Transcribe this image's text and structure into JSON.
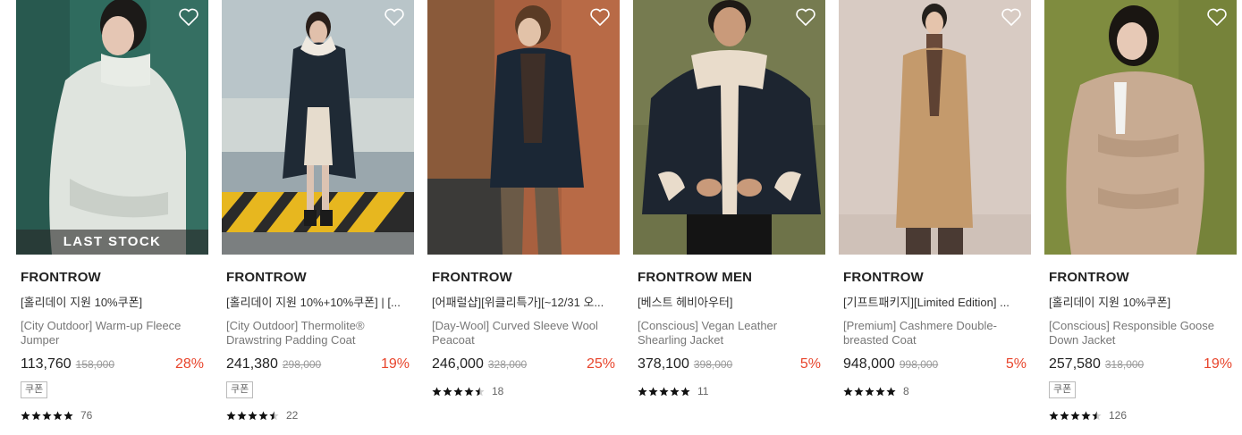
{
  "colors": {
    "discount": "#e8452c",
    "badge_bg": "#3a3a3a"
  },
  "products": [
    {
      "brand": "FRONTROW",
      "promo": "[홀리데이 지원 10%쿠폰]",
      "name": "[City Outdoor] Warm-up Fleece Jumper",
      "price": "113,760",
      "original_price": "158,000",
      "discount": "28%",
      "badge": "LAST STOCK",
      "coupon": "쿠폰",
      "rating": 5,
      "reviews": "76",
      "icon": "heart-outline-icon"
    },
    {
      "brand": "FRONTROW",
      "promo": "[홀리데이 지원 10%+10%쿠폰] | [...",
      "name": "[City Outdoor] Thermolite® Drawstring Padding Coat",
      "price": "241,380",
      "original_price": "298,000",
      "discount": "19%",
      "coupon": "쿠폰",
      "rating": 4.5,
      "reviews": "22",
      "icon": "heart-outline-icon"
    },
    {
      "brand": "FRONTROW",
      "promo": "[어패럴샵][위클리특가][~12/31 오...",
      "name": "[Day-Wool] Curved Sleeve Wool Peacoat",
      "price": "246,000",
      "original_price": "328,000",
      "discount": "25%",
      "rating": 4.5,
      "reviews": "18",
      "icon": "heart-outline-icon"
    },
    {
      "brand": "FRONTROW MEN",
      "promo": "[베스트 헤비아우터]",
      "name": "[Conscious] Vegan Leather Shearling Jacket",
      "price": "378,100",
      "original_price": "398,000",
      "discount": "5%",
      "rating": 5,
      "reviews": "11",
      "icon": "heart-outline-icon"
    },
    {
      "brand": "FRONTROW",
      "promo": "[기프트패키지][Limited Edition] ...",
      "name": "[Premium] Cashmere Double-breasted Coat",
      "price": "948,000",
      "original_price": "998,000",
      "discount": "5%",
      "rating": 5,
      "reviews": "8",
      "icon": "heart-outline-icon"
    },
    {
      "brand": "FRONTROW",
      "promo": "[홀리데이 지원 10%쿠폰]",
      "name": "[Conscious] Responsible Goose Down Jacket",
      "price": "257,580",
      "original_price": "318,000",
      "discount": "19%",
      "coupon": "쿠폰",
      "rating": 4.5,
      "reviews": "126",
      "icon": "heart-outline-icon"
    }
  ]
}
